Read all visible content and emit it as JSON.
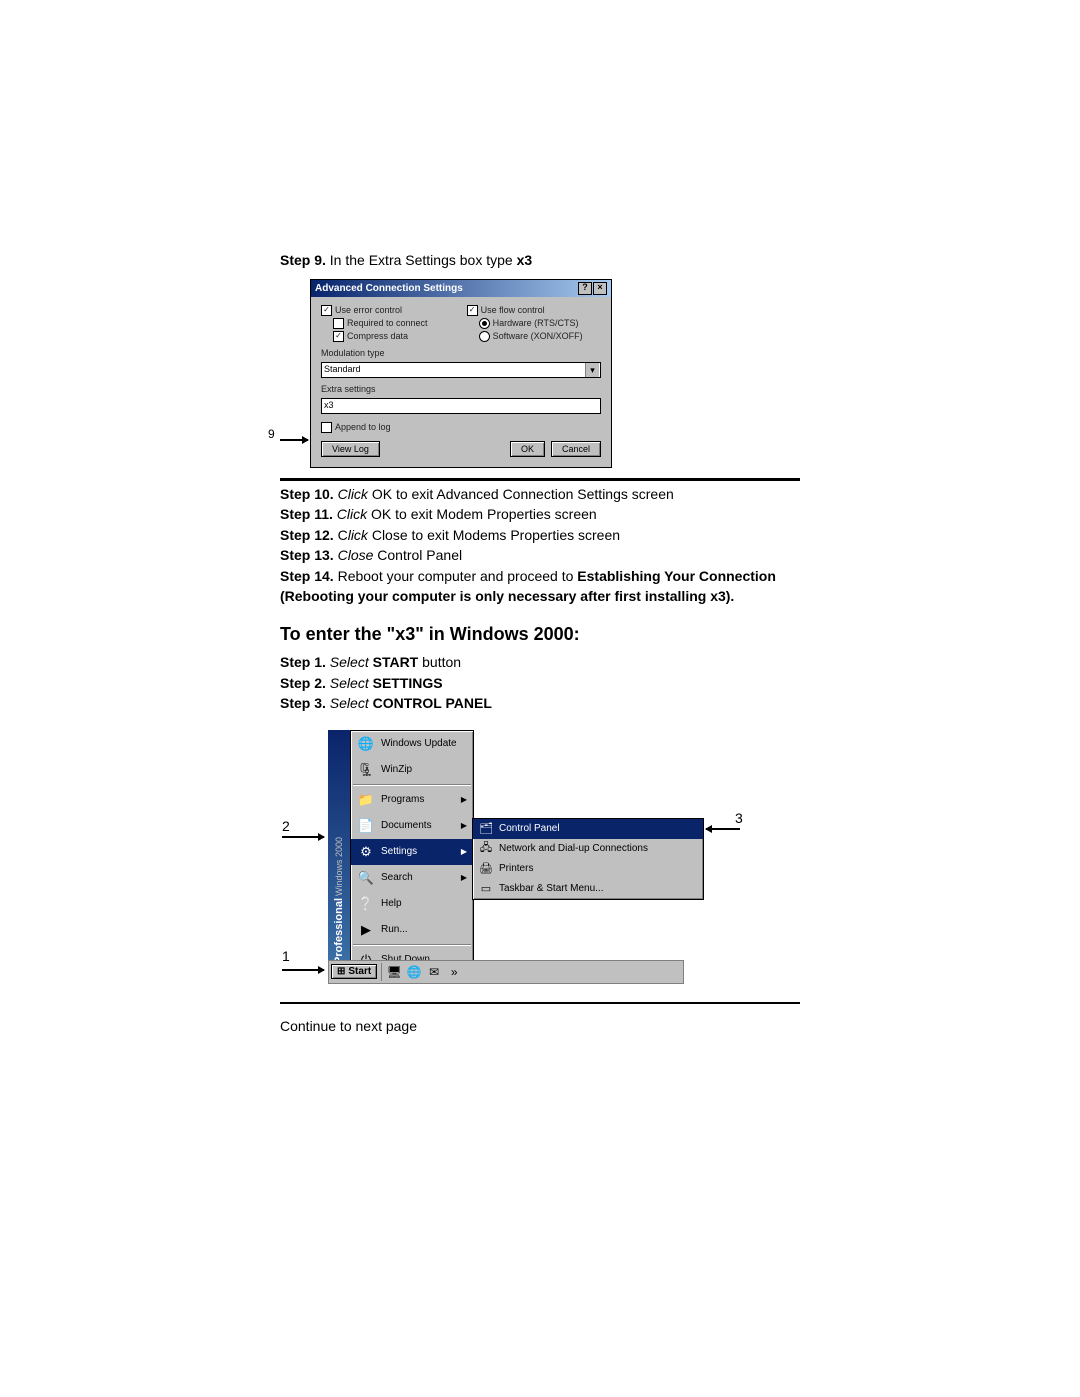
{
  "step9": {
    "label": "Step 9.",
    "text_a": " In the Extra Settings box type ",
    "bold_tail": "x3"
  },
  "dialog": {
    "title": "Advanced Connection Settings",
    "use_error": "Use error control",
    "req_connect": "Required to connect",
    "compress": "Compress data",
    "use_flow": "Use flow control",
    "hw": "Hardware (RTS/CTS)",
    "sw": "Software (XON/XOFF)",
    "mod_type": "Modulation type",
    "mod_val": "Standard",
    "extra": "Extra settings",
    "extra_val": "x3",
    "append": "Append to log",
    "viewlog": "View Log",
    "ok": "OK",
    "cancel": "Cancel",
    "callout": "9"
  },
  "steps_mid": {
    "s10": {
      "label": "Step 10.",
      "italic": " Click",
      "rest": " OK to exit Advanced Connection Settings screen"
    },
    "s11": {
      "label": "Step 11.",
      "italic": " Click",
      "rest": " OK to exit Modem Properties screen"
    },
    "s12": {
      "label": "Step 12.",
      "pre": " C",
      "italic": "lick",
      "rest": " Close to exit Modems Properties screen"
    },
    "s13": {
      "label": "Step 13.",
      "italic": " Close",
      "rest": " Control Panel"
    },
    "s14": {
      "label": "Step 14.",
      "rest_a": " Reboot your computer and proceed to ",
      "bold_a": "Establishing Your Connection (Rebooting your computer is only necessary after first installing x3)."
    }
  },
  "section_heading": "To enter the \"x3\" in Windows 2000:",
  "steps_bot": {
    "s1": {
      "label": "Step 1.",
      "italic": " Select ",
      "bold": "START",
      "tail": " button"
    },
    "s2": {
      "label": "Step 2.",
      "italic": " Select ",
      "bold": "SETTINGS"
    },
    "s3": {
      "label": "Step 3.",
      "italic": " Select ",
      "bold": "CONTROL PANEL"
    }
  },
  "startmenu": {
    "sidebar_prof": "Professional",
    "sidebar_win": "Windows 2000",
    "items": {
      "winupdate": "Windows Update",
      "winzip": "WinZip",
      "programs": "Programs",
      "documents": "Documents",
      "settings": "Settings",
      "search": "Search",
      "help": "Help",
      "run": "Run...",
      "shutdown": "Shut Down..."
    },
    "submenu": {
      "cp": "Control Panel",
      "net": "Network and Dial-up Connections",
      "printers": "Printers",
      "taskbar": "Taskbar & Start Menu..."
    },
    "taskbar": {
      "start": "Start"
    },
    "callouts": {
      "c1": "1",
      "c2": "2",
      "c3": "3"
    }
  },
  "continue": "Continue to next page"
}
